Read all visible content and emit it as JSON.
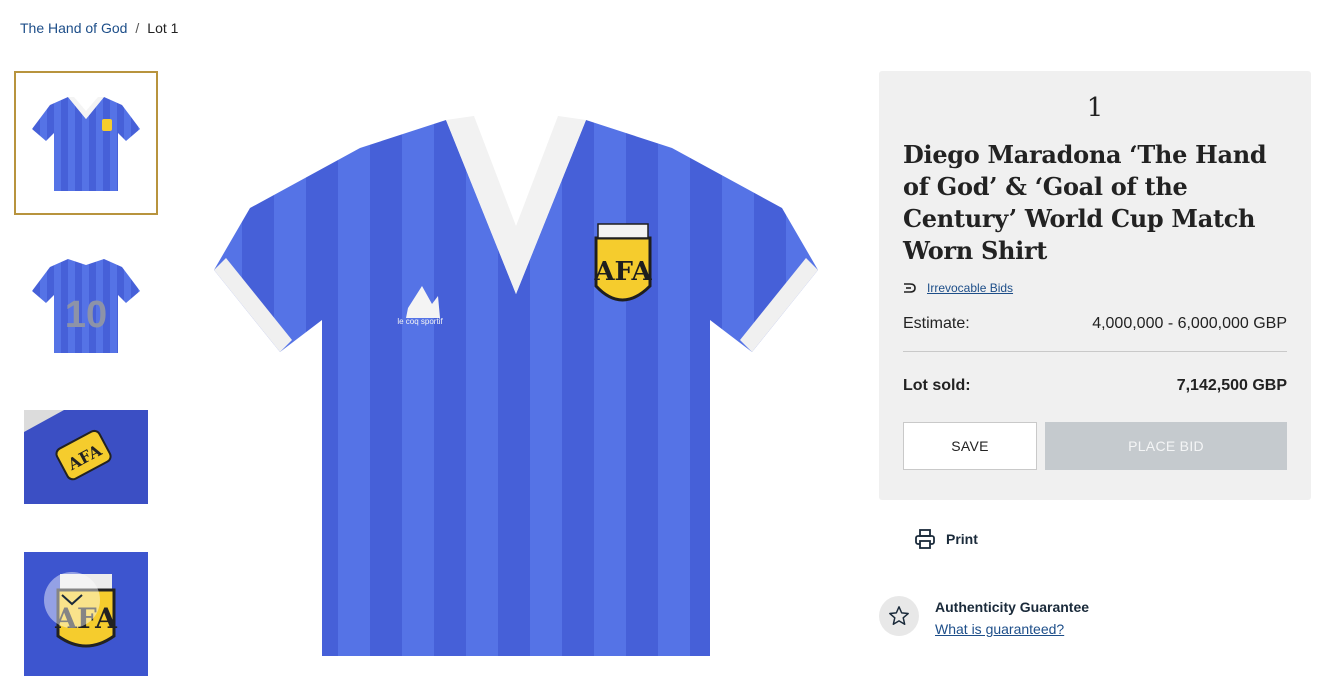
{
  "breadcrumb": {
    "parent": "The Hand of God",
    "separator": "/",
    "current": "Lot 1"
  },
  "gallery": {
    "thumbnails": [
      {
        "name": "shirt-front",
        "selected": true
      },
      {
        "name": "shirt-back-10",
        "selected": false
      },
      {
        "name": "crest-angle",
        "selected": false
      },
      {
        "name": "crest-closeup",
        "selected": false
      }
    ],
    "patch_text": "AFA",
    "brand_text": "le coq sportif",
    "back_number": "10",
    "scroll_icon": "chevron-down-icon"
  },
  "lot": {
    "number": "1",
    "title": "Diego Maradona ‘The Hand of God’ & ‘Goal of the Century’ World Cup Match Worn Shirt",
    "irrevocable_label": "Irrevocable Bids",
    "estimate_label": "Estimate:",
    "estimate_value": "4,000,000 - 6,000,000 GBP",
    "sold_label": "Lot sold:",
    "sold_value": "7,142,500 GBP",
    "save_label": "SAVE",
    "bid_label": "PLACE BID"
  },
  "print_label": "Print",
  "authenticity": {
    "title": "Authenticity Guarantee",
    "link": "What is guaranteed?"
  },
  "colors": {
    "accent": "#b8943e",
    "link": "#1d4e89",
    "panel": "#f0f0f0",
    "shirt": "#4a63d6",
    "disabled": "#c5cace"
  }
}
